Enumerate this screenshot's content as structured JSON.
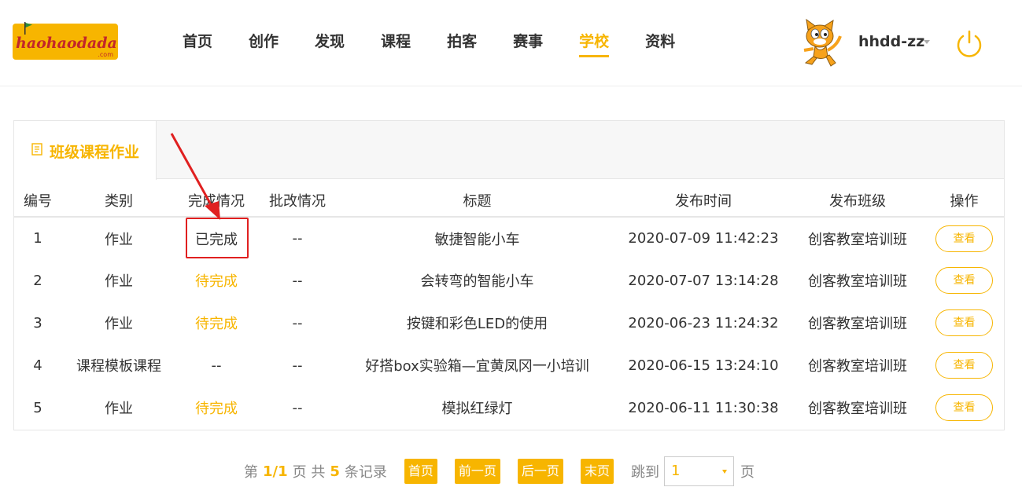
{
  "brand": {
    "logo_text": "haohaodada",
    "logo_suffix": ".com",
    "accent": "#f7b500"
  },
  "nav": {
    "items": [
      "首页",
      "创作",
      "发现",
      "课程",
      "拍客",
      "赛事",
      "学校",
      "资料"
    ],
    "active_index": 6
  },
  "user": {
    "name": "hhdd-zz"
  },
  "panel": {
    "tab_label": "班级课程作业"
  },
  "table": {
    "headers": [
      "编号",
      "类别",
      "完成情况",
      "批改情况",
      "标题",
      "发布时间",
      "发布班级",
      "操作"
    ],
    "rows": [
      {
        "no": "1",
        "type": "作业",
        "status": "已完成",
        "status_kind": "done",
        "review": "--",
        "title": "敏捷智能小车",
        "time": "2020-07-09 11:42:23",
        "class": "创客教室培训班",
        "action": "查看"
      },
      {
        "no": "2",
        "type": "作业",
        "status": "待完成",
        "status_kind": "pending",
        "review": "--",
        "title": "会转弯的智能小车",
        "time": "2020-07-07 13:14:28",
        "class": "创客教室培训班",
        "action": "查看"
      },
      {
        "no": "3",
        "type": "作业",
        "status": "待完成",
        "status_kind": "pending",
        "review": "--",
        "title": "按键和彩色LED的使用",
        "time": "2020-06-23 11:24:32",
        "class": "创客教室培训班",
        "action": "查看"
      },
      {
        "no": "4",
        "type": "课程模板课程",
        "status": "--",
        "status_kind": "none",
        "review": "--",
        "title": "好搭box实验箱—宜黄凤冈一小培训",
        "time": "2020-06-15 13:24:10",
        "class": "创客教室培训班",
        "action": "查看"
      },
      {
        "no": "5",
        "type": "作业",
        "status": "待完成",
        "status_kind": "pending",
        "review": "--",
        "title": "模拟红绿灯",
        "time": "2020-06-11 11:30:38",
        "class": "创客教室培训班",
        "action": "查看"
      }
    ]
  },
  "pager": {
    "prefix": "第",
    "page": "1/1",
    "page_unit": "页 共",
    "total": "5",
    "total_unit": "条记录",
    "first": "首页",
    "prev": "前一页",
    "next": "后一页",
    "last": "末页",
    "jump_label": "跳到",
    "jump_value": "1",
    "jump_suffix": "页"
  },
  "annotation": {
    "color": "#e02020"
  }
}
